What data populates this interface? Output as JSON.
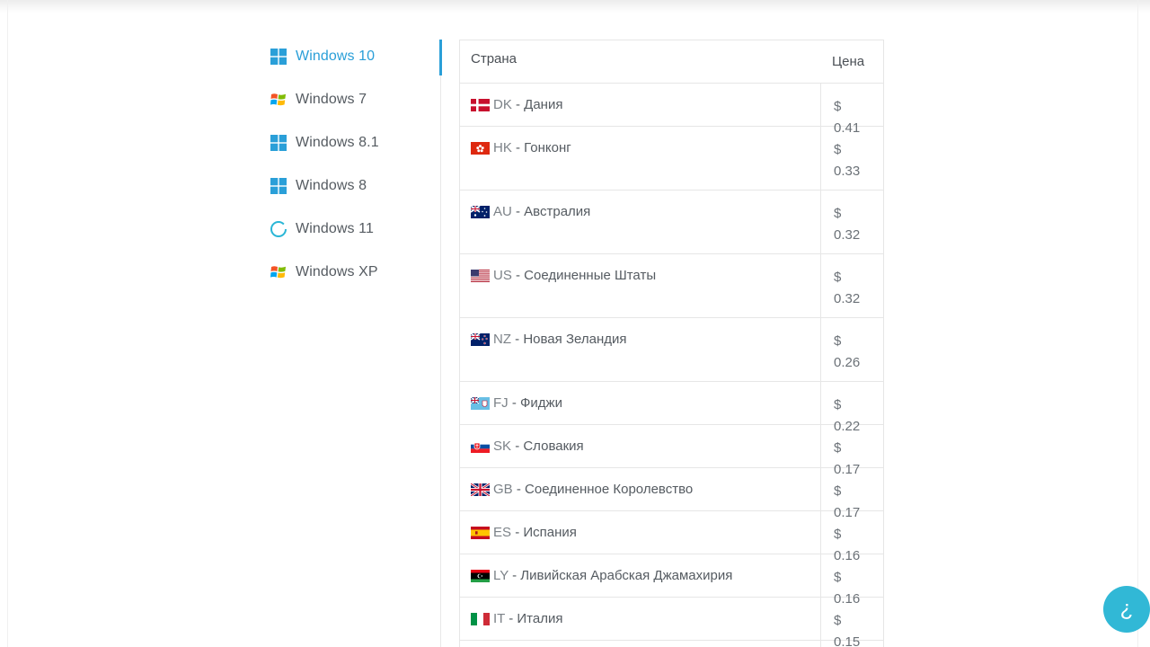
{
  "sidebar": {
    "items": [
      {
        "label": "Windows 10",
        "icon": "windows-logo-icon",
        "active": true
      },
      {
        "label": "Windows 7",
        "icon": "windows-flag-icon",
        "active": false
      },
      {
        "label": "Windows 8.1",
        "icon": "windows-logo-icon",
        "active": false
      },
      {
        "label": "Windows 8",
        "icon": "windows-logo-icon",
        "active": false
      },
      {
        "label": "Windows 11",
        "icon": "windows-11-ring-icon",
        "active": false
      },
      {
        "label": "Windows XP",
        "icon": "windows-flag-icon",
        "active": false
      }
    ]
  },
  "table": {
    "headers": {
      "country": "Страна",
      "price": "Цена"
    },
    "rows": [
      {
        "flag": "DK",
        "code": "DK",
        "name": "- Дания",
        "price": "$ 0.41"
      },
      {
        "flag": "HK",
        "code": "HK",
        "name": "- Гонконг",
        "price": "$ 0.33"
      },
      {
        "flag": "AU",
        "code": "AU",
        "name": "- Австралия",
        "price": "$ 0.32"
      },
      {
        "flag": "US",
        "code": "US",
        "name": "- Соединенные Штаты",
        "price": "$ 0.32"
      },
      {
        "flag": "NZ",
        "code": "NZ",
        "name": "- Новая Зеландия",
        "price": "$ 0.26"
      },
      {
        "flag": "FJ",
        "code": "FJ",
        "name": "- Фиджи",
        "price": "$ 0.22"
      },
      {
        "flag": "SK",
        "code": "SK",
        "name": "- Словакия",
        "price": "$ 0.17"
      },
      {
        "flag": "GB",
        "code": "GB",
        "name": "- Соединенное Королевство",
        "price": "$ 0.17"
      },
      {
        "flag": "ES",
        "code": "ES",
        "name": "- Испания",
        "price": "$ 0.16"
      },
      {
        "flag": "LY",
        "code": "LY",
        "name": "- Ливийская Арабская Джамахирия",
        "price": "$ 0.16"
      },
      {
        "flag": "IT",
        "code": "IT",
        "name": "- Италия",
        "price": "$ 0.15"
      }
    ]
  },
  "chat": {
    "glyph": "¿",
    "icon": "chat-help-icon"
  },
  "colors": {
    "accent": "#2a9fd8",
    "chat": "#31b8d6"
  }
}
